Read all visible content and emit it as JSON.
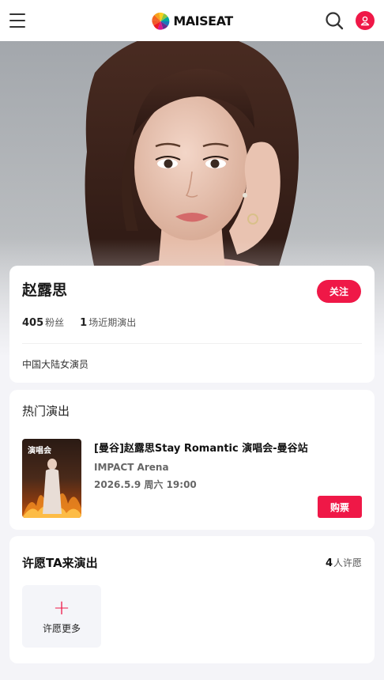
{
  "header": {
    "brand": "MAISEAT",
    "icons": [
      "menu-icon",
      "search-icon",
      "user-icon"
    ]
  },
  "artist": {
    "name": "赵露思",
    "follow_label": "关注",
    "fans_count": "405",
    "fans_label": "粉丝",
    "shows_count": "1",
    "shows_label": "场近期演出",
    "description": "中国大陆女演员"
  },
  "hot_shows": {
    "section_title": "热门演出",
    "items": [
      {
        "poster_text": "演唱会",
        "title": "[曼谷]赵露思Stay Romantic 演唱会-曼谷站",
        "venue": "IMPACT Arena",
        "date": "2026.5.9 周六 19:00",
        "buy_label": "购票"
      }
    ]
  },
  "wish": {
    "title": "许愿TA来演出",
    "count": "4",
    "count_label": "人许愿",
    "add_label": "许愿更多"
  },
  "colors": {
    "accent": "#ef1847",
    "background": "#f4f4f8",
    "card": "#ffffff"
  }
}
